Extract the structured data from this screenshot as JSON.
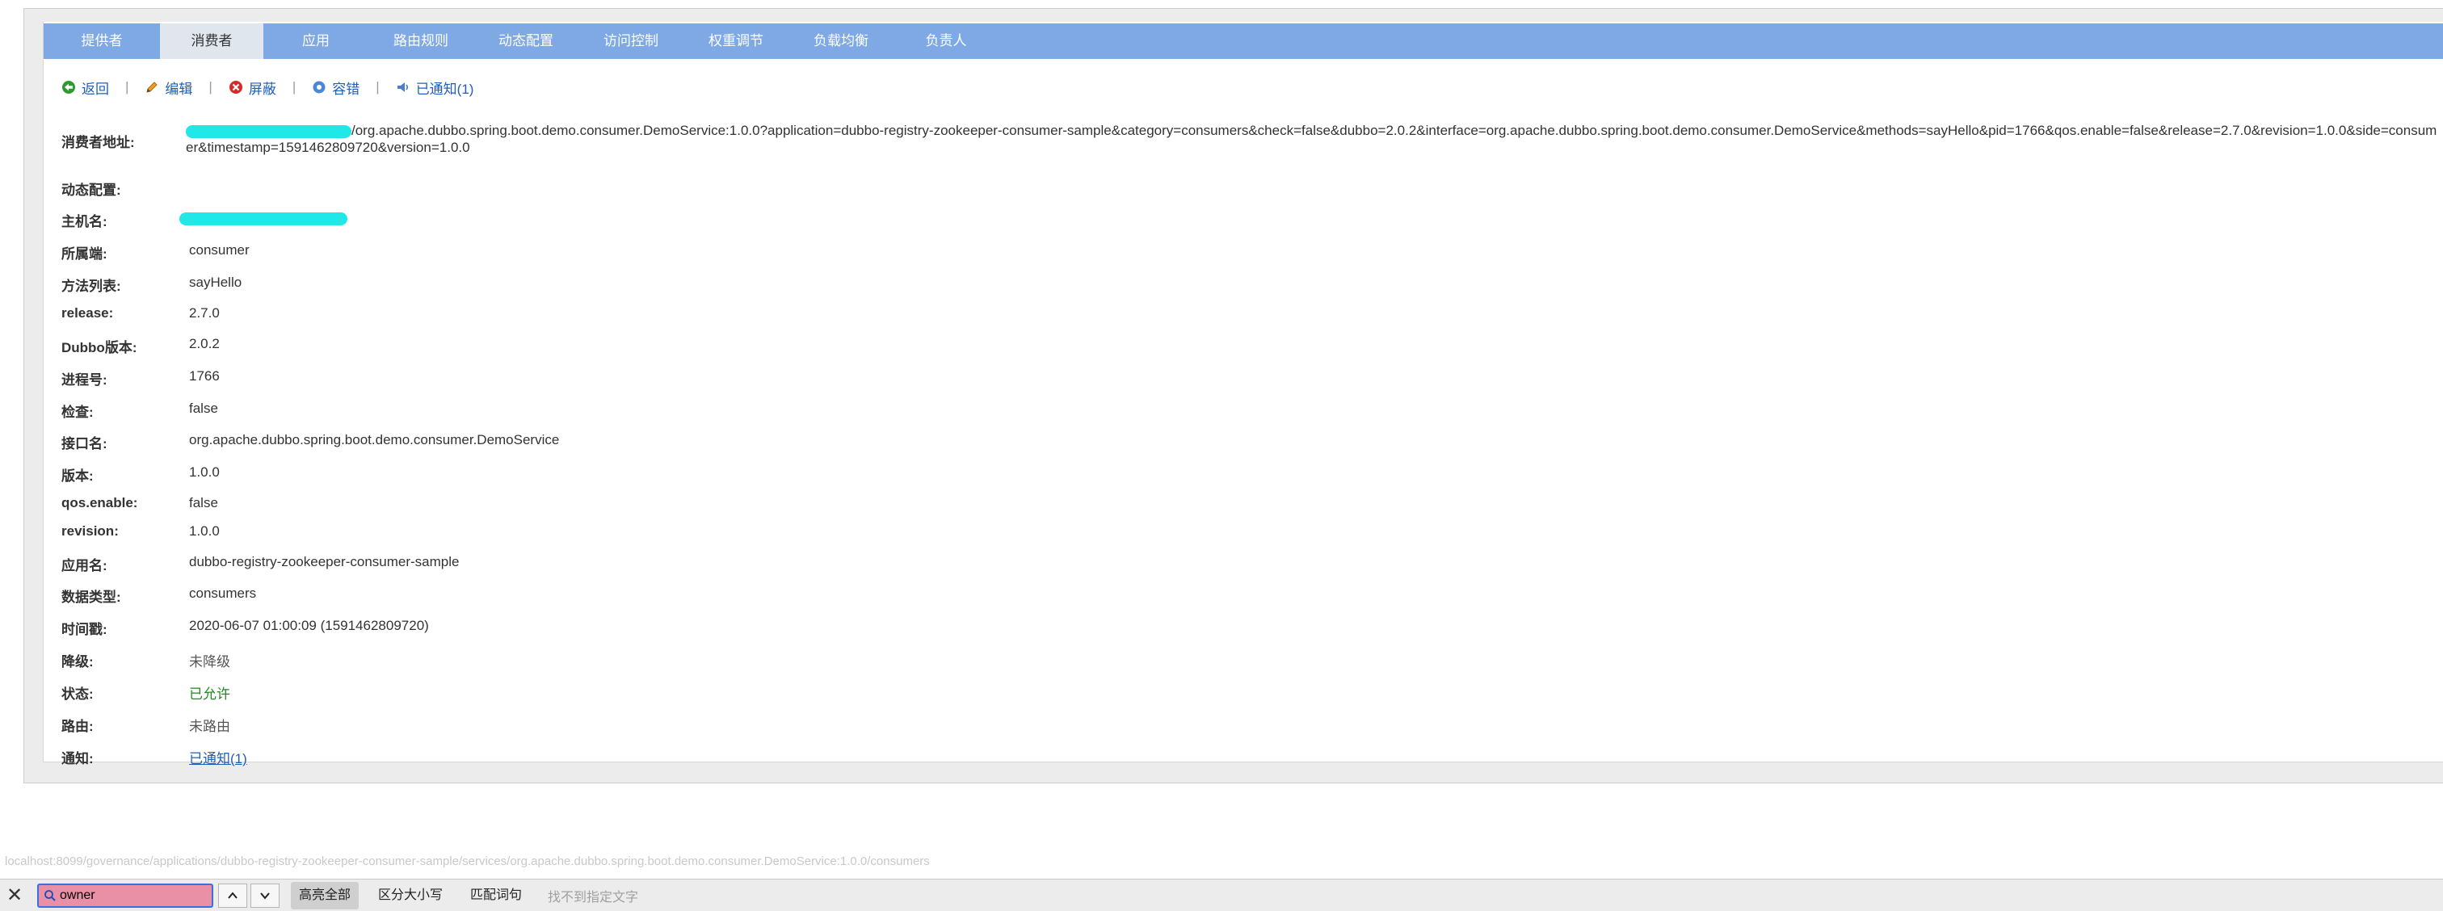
{
  "tabs": [
    {
      "label": "提供者",
      "active": false
    },
    {
      "label": "消费者",
      "active": true
    },
    {
      "label": "应用",
      "active": false
    },
    {
      "label": "路由规则",
      "active": false
    },
    {
      "label": "动态配置",
      "active": false
    },
    {
      "label": "访问控制",
      "active": false
    },
    {
      "label": "权重调节",
      "active": false
    },
    {
      "label": "负载均衡",
      "active": false
    },
    {
      "label": "负责人",
      "active": false
    }
  ],
  "actions": {
    "back": "返回",
    "edit": "编辑",
    "shield": "屏蔽",
    "tolerance": "容错",
    "notified": "已通知(1)",
    "separator": "|"
  },
  "details": {
    "address_label": "消费者地址:",
    "address_value": "/org.apache.dubbo.spring.boot.demo.consumer.DemoService:1.0.0?application=dubbo-registry-zookeeper-consumer-sample&category=consumers&check=false&dubbo=2.0.2&interface=org.apache.dubbo.spring.boot.demo.consumer.DemoService&methods=sayHello&pid=1766&qos.enable=false&release=2.7.0&revision=1.0.0&side=consumer&timestamp=1591462809720&version=1.0.0",
    "dynamic_label": "动态配置:",
    "hostname_label": "主机名:",
    "side_label": "所属端:",
    "side_value": "consumer",
    "methods_label": "方法列表:",
    "methods_value": "sayHello",
    "release_label": "release:",
    "release_value": "2.7.0",
    "dubbo_label": "Dubbo版本:",
    "dubbo_value": "2.0.2",
    "pid_label": "进程号:",
    "pid_value": "1766",
    "check_label": "检查:",
    "check_value": "false",
    "interface_label": "接口名:",
    "interface_value": "org.apache.dubbo.spring.boot.demo.consumer.DemoService",
    "version_label": "版本:",
    "version_value": "1.0.0",
    "qos_label": "qos.enable:",
    "qos_value": "false",
    "revision_label": "revision:",
    "revision_value": "1.0.0",
    "app_label": "应用名:",
    "app_value": "dubbo-registry-zookeeper-consumer-sample",
    "category_label": "数据类型:",
    "category_value": "consumers",
    "timestamp_label": "时间戳:",
    "timestamp_value": "2020-06-07 01:00:09 (1591462809720)",
    "degrade_label": "降级:",
    "degrade_value": "未降级",
    "status_label": "状态:",
    "status_value": "已允许",
    "route_label": "路由:",
    "route_value": "未路由",
    "notify_label": "通知:",
    "notify_value": "已通知(1)"
  },
  "status_url": "localhost:8099/governance/applications/dubbo-registry-zookeeper-consumer-sample/services/org.apache.dubbo.spring.boot.demo.consumer.DemoService:1.0.0/consumers",
  "findbar": {
    "query": "owner",
    "highlight_all": "高亮全部",
    "match_case": "区分大小写",
    "whole_word": "匹配词句",
    "status": "找不到指定文字"
  },
  "colors": {
    "tab_bar": "#7fa9e4",
    "link": "#1f5fb8",
    "status_ok": "#1f8a1f",
    "redaction": "#21e8e8",
    "find_input_bg": "#e98fa6"
  }
}
